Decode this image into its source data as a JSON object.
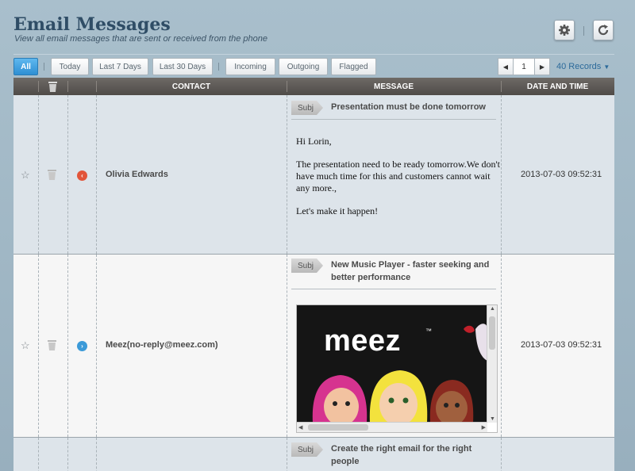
{
  "header": {
    "title": "Email Messages",
    "subtitle": "View all email messages that are sent or received from the phone"
  },
  "toolbar": {
    "settings_icon": "gear-icon",
    "refresh_icon": "refresh-icon"
  },
  "filters": [
    {
      "label": "All",
      "active": true
    },
    {
      "label": "Today"
    },
    {
      "label": "Last 7 Days"
    },
    {
      "label": "Last 30 Days"
    },
    {
      "label": "Incoming"
    },
    {
      "label": "Outgoing"
    },
    {
      "label": "Flagged"
    }
  ],
  "pager": {
    "prev": "◀",
    "page": "1",
    "next": "▶",
    "records": "40 Records",
    "records_caret": "▼"
  },
  "columns": {
    "contact": "CONTACT",
    "message": "MESSAGE",
    "datetime": "DATE AND TIME"
  },
  "messages": [
    {
      "direction": "incoming",
      "contact": "Olivia Edwards",
      "subject_tag": "Subj",
      "subject": "Presentation must be done tomorrow",
      "body": [
        "Hi Lorin,",
        "The presentation need to be ready tomorrow.We don't have much time for this and customers cannot wait any more.,",
        "Let's make it happen!"
      ],
      "datetime": "2013-07-03 09:52:31"
    },
    {
      "direction": "outgoing",
      "contact": "Meez(no-reply@meez.com)",
      "subject_tag": "Subj",
      "subject": "New Music Player - faster seeking and better performance",
      "image_logo": "meez",
      "image_tm": "™",
      "datetime": "2013-07-03 09:52:31"
    },
    {
      "subject_tag": "Subj",
      "subject": "Create the right email for the right people"
    }
  ],
  "colors": {
    "accent": "#2e8fd3",
    "incoming": "#e2553a",
    "outgoing": "#3b9ad8"
  }
}
